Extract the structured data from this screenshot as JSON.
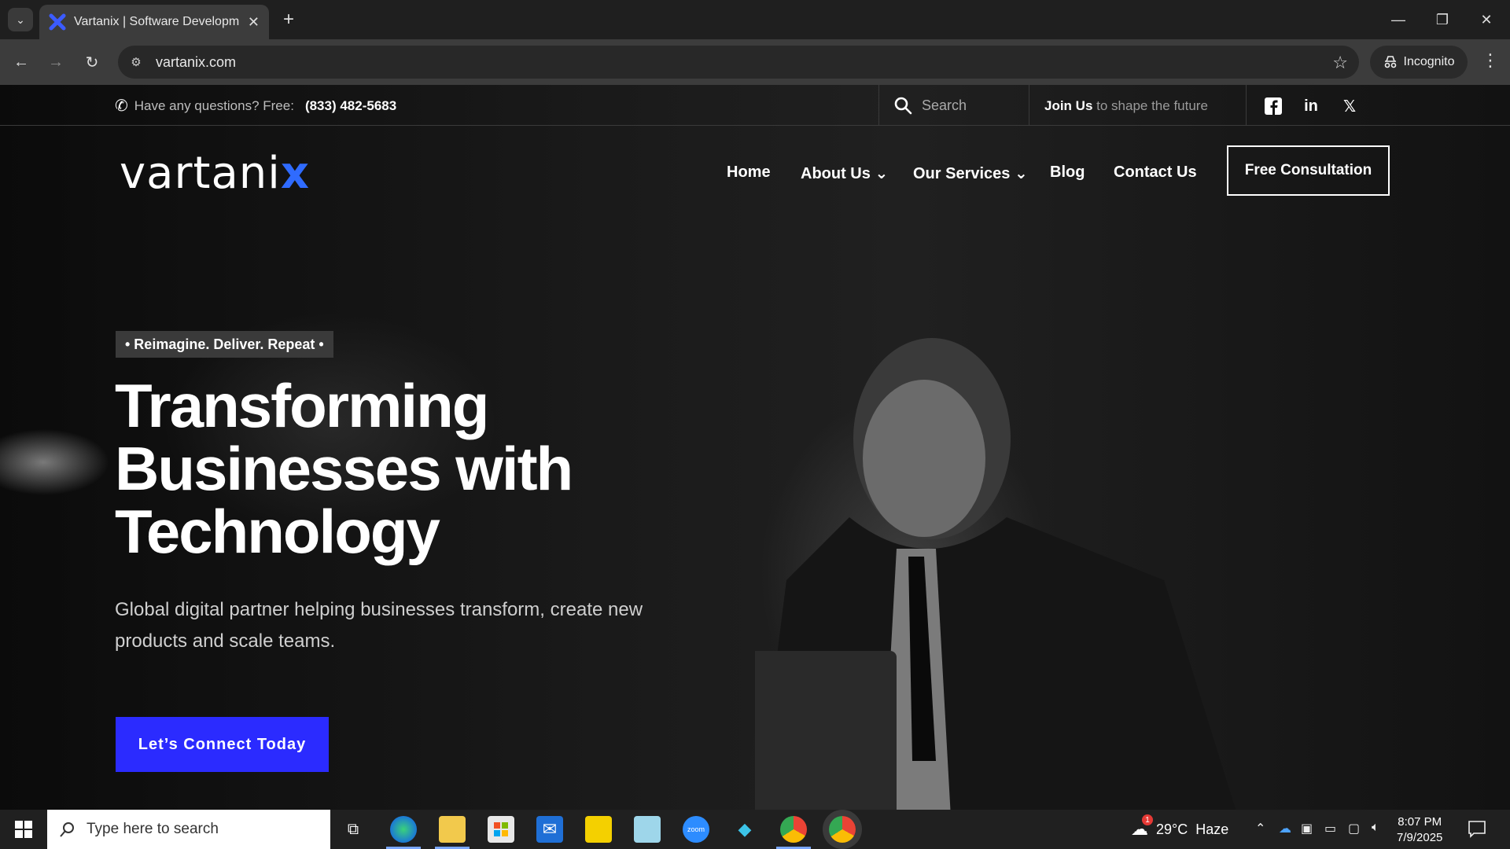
{
  "browser": {
    "tab_title": "Vartanix | Software Development",
    "tab_close": "✕",
    "new_tab": "+",
    "url": "vartanix.com",
    "incognito_label": "Incognito"
  },
  "site": {
    "topbar": {
      "question": "Have any questions? Free:",
      "phone": "(833) 482-5683",
      "search_placeholder": "Search",
      "join_bold": "Join Us",
      "join_rest": "to shape the future",
      "social": [
        "facebook-icon",
        "linkedin-icon",
        "x-icon"
      ]
    },
    "logo": {
      "text": "vartani",
      "accent": "x"
    },
    "nav": {
      "home": "Home",
      "about": "About Us",
      "services": "Our Services",
      "blog": "Blog",
      "contact": "Contact Us",
      "cta": "Free Consultation"
    },
    "hero": {
      "tagline": "• Reimagine. Deliver. Repeat •",
      "headline_1": "Transforming",
      "headline_2": "Businesses with",
      "headline_3": "Technology",
      "sub_1": "Global digital partner helping businesses transform, create new",
      "sub_2": "products and scale teams.",
      "cta": "Let’s Connect Today"
    },
    "colors": {
      "accent": "#2b2bff",
      "logo_x": "#2f6bff"
    }
  },
  "taskbar": {
    "search_placeholder": "Type here to search",
    "weather": "29°C  Haze",
    "weather_badge": "1",
    "time": "8:07 PM",
    "date": "7/9/2025",
    "zoom_label": "zoom"
  }
}
